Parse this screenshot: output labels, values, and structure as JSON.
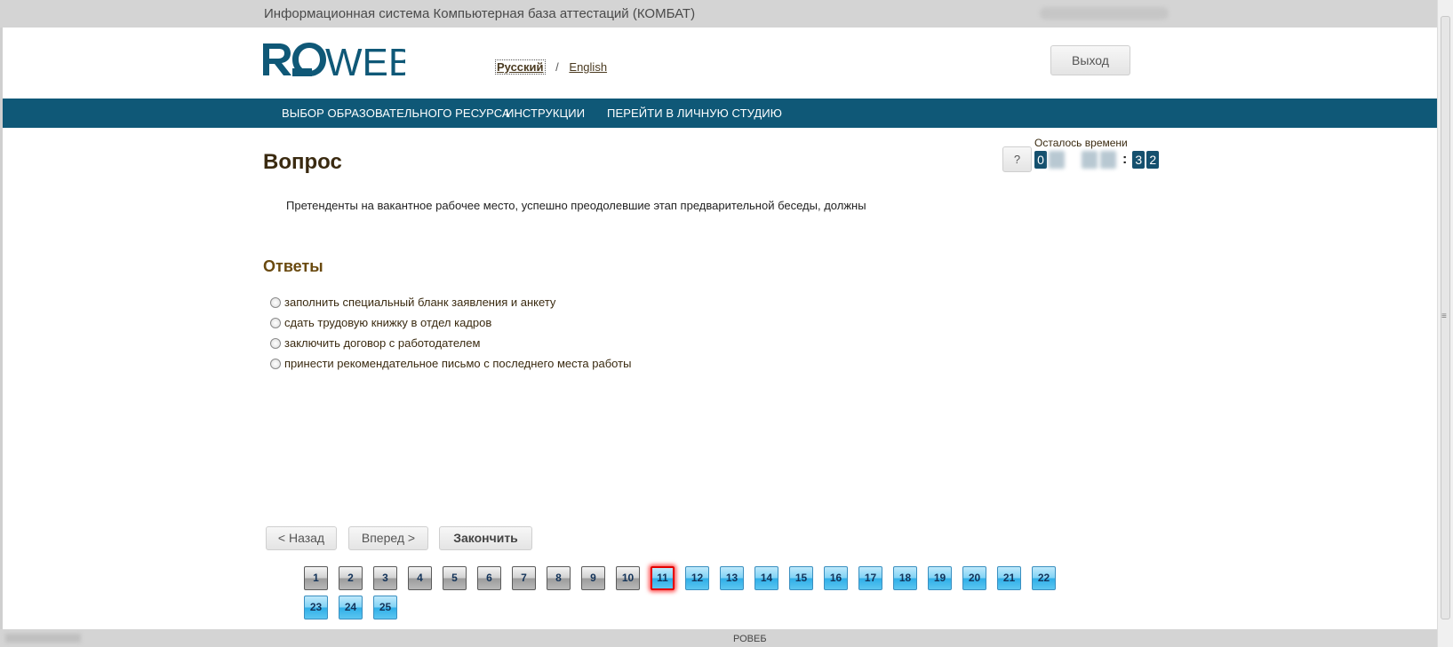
{
  "header": {
    "system_title": "Информационная система Компьютерная база аттестаций (КОМБАТ)",
    "logo_text": "ROWEB",
    "logout_label": "Выход",
    "languages": [
      {
        "label": "Русский",
        "active": true
      },
      {
        "label": "English",
        "active": false
      }
    ],
    "lang_separator": "/"
  },
  "nav": {
    "items": [
      {
        "label": "ВЫБОР ОБРАЗОВАТЕЛЬНОГО РЕСУРСА"
      },
      {
        "label": "ИНСТРУКЦИИ"
      },
      {
        "label": "ПЕРЕЙТИ В ЛИЧНУЮ СТУДИЮ"
      }
    ]
  },
  "question": {
    "heading": "Вопрос",
    "text": "Претенденты на вакантное рабочее место, успешно преодолевшие этап предварительной беседы, должны",
    "help_label": "?"
  },
  "answers": {
    "heading": "Ответы",
    "options": [
      {
        "label": "заполнить специальный бланк заявления и анкету"
      },
      {
        "label": "сдать трудовую книжку в отдел кадров"
      },
      {
        "label": "заключить договор с работодателем"
      },
      {
        "label": "принести рекомендательное письмо с последнего места работы"
      }
    ]
  },
  "timer": {
    "label": "Осталось времени",
    "first_digit": "0",
    "seconds_digits": [
      "3",
      "2"
    ],
    "separator": ":"
  },
  "controls": {
    "back_label": "< Назад",
    "forward_label": "Вперед >",
    "finish_label": "Закончить"
  },
  "pager": {
    "current": 11,
    "answered_up_to": 10,
    "total": 25
  },
  "footer": {
    "text": "РОВЕБ"
  },
  "colors": {
    "nav_bg": "#0f5877",
    "heading_brown": "#3a2a10",
    "answers_heading": "#6a4a10",
    "current_question_border": "#e30000"
  }
}
